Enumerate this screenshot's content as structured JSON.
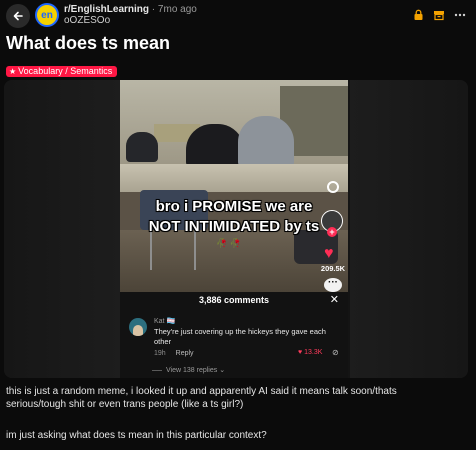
{
  "header": {
    "subreddit": "r/EnglishLearning",
    "separator": "·",
    "age": "7mo ago",
    "author": "oOZESOo",
    "avatar_text": "en",
    "icons": [
      "back-arrow-icon",
      "lock-icon",
      "archive-icon",
      "more-icon"
    ]
  },
  "post": {
    "title": "What does ts mean",
    "flair": "Vocabulary / Semantics",
    "flair_color": "#ff1744",
    "body": [
      "this is just a random meme, i looked it up and apparently AI said it means talk soon/thats serious/tough shit or even trans people (like a ts girl?)",
      "im just asking what does ts mean in this particular context?"
    ]
  },
  "media": {
    "caption_line1": "bro i PROMISE we are",
    "caption_line2": "NOT INTIMIDATED by ts",
    "caption_emoji": "🥀 🥀",
    "likes": "209.5K",
    "comments_header": "3,886 comments",
    "comment": {
      "user": "Kat",
      "user_flag": "🏳️‍⚧️",
      "text": "They're just covering up the hickeys they gave each other",
      "time": "19h",
      "reply_label": "Reply",
      "likes": "13.3K",
      "view_replies": "View 138 replies"
    }
  },
  "colors": {
    "background": "#0b0b0b",
    "accent_red": "#ff1744",
    "like_pink": "#ff2d55",
    "avatar_yellow": "#f5d000",
    "avatar_blue": "#1e66ff"
  }
}
